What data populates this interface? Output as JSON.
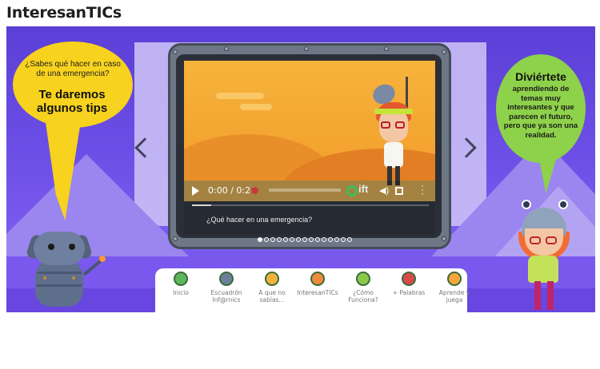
{
  "page": {
    "title": "InteresanTICs"
  },
  "slide": {
    "left_bubble": {
      "question": "¿Sabes qué hacer en caso de una emergencia?",
      "tip": "Te daremos algunos tips"
    },
    "right_bubble": {
      "title": "Diviértete",
      "text": "aprendiendo de temas muy interesantes y que parecen el futuro, pero que ya son una realidad."
    }
  },
  "video": {
    "current_time": "0:00",
    "duration": "0:24",
    "progress_fraction": 0.0,
    "logo_text": "ift",
    "caption": "¿Qué hacer en una emergencia?"
  },
  "carousel": {
    "slide_count": 15,
    "active_index": 0
  },
  "menu": {
    "items": [
      {
        "label": "Inicio",
        "icon": "home-icon",
        "color": "#5fb65a"
      },
      {
        "label": "Escuadrón Inf@rnics",
        "icon": "squad-icon",
        "color": "#6b7f99"
      },
      {
        "label": "A que no sabías...",
        "icon": "idea-icon",
        "color": "#f3b23a"
      },
      {
        "label": "InteresanTICs",
        "icon": "interesantics-icon",
        "color": "#f08a3c"
      },
      {
        "label": "¿Cómo Funciona?",
        "icon": "gear-icon",
        "color": "#8cc94a"
      },
      {
        "label": "+ Palabras",
        "icon": "words-icon",
        "color": "#d94a4a"
      },
      {
        "label": "Aprende y juega",
        "icon": "game-icon",
        "color": "#f6a53a"
      }
    ]
  }
}
